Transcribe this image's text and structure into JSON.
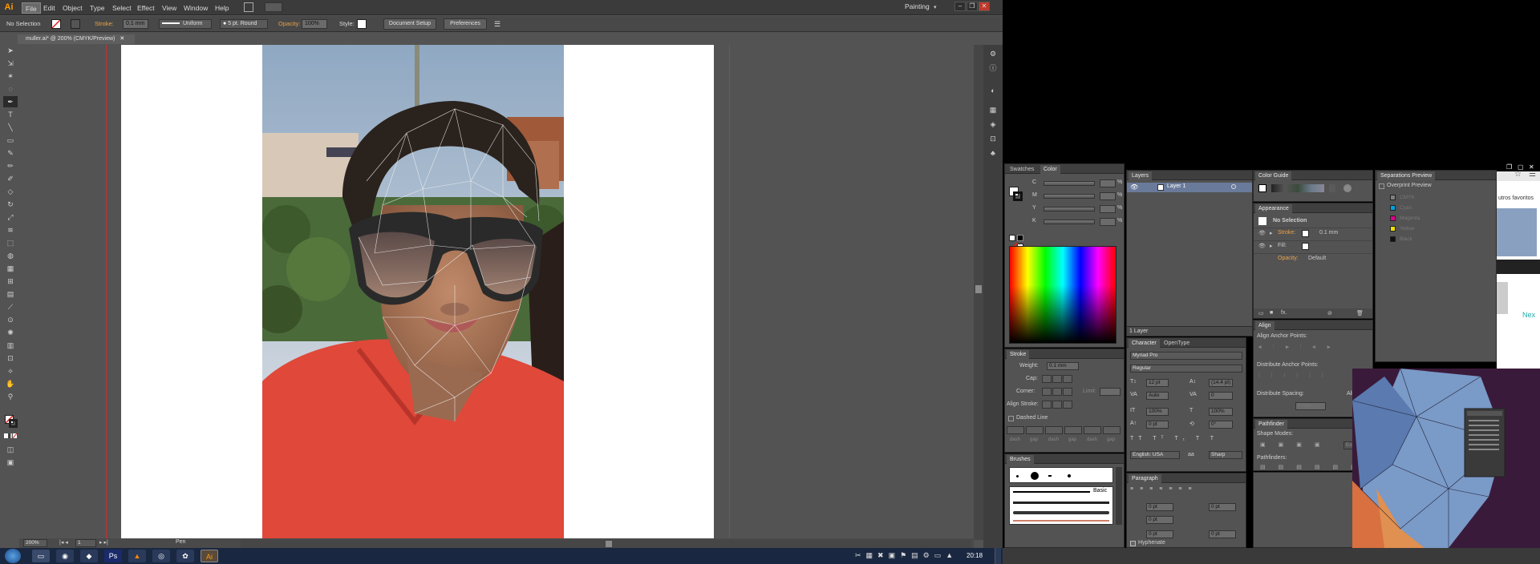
{
  "menubar": {
    "app_logo": "Ai",
    "items": [
      "File",
      "Edit",
      "Object",
      "Type",
      "Select",
      "Effect",
      "View",
      "Window",
      "Help"
    ],
    "workspace": "Painting"
  },
  "control_bar": {
    "selection": "No Selection",
    "stroke_label": "Stroke:",
    "stroke_value": "0.1 mm",
    "profile": "Uniform",
    "brush": "5 pt. Round",
    "opacity_label": "Opacity:",
    "opacity_value": "100%",
    "style_label": "Style:",
    "document_setup": "Document Setup",
    "preferences": "Preferences"
  },
  "document": {
    "tab_title": "muller.ai* @ 200% (CMYK/Preview)",
    "zoom": "200%",
    "page": "1",
    "status": "Pen"
  },
  "panels": {
    "swatches_tab": "Swatches",
    "color_tab": "Color",
    "color_labels": [
      "C",
      "M",
      "Y",
      "K"
    ],
    "percent": "%",
    "stroke": {
      "title": "Stroke",
      "weight_label": "Weight:",
      "weight_value": "0.1 mm",
      "cap_label": "Cap:",
      "corner_label": "Corner:",
      "limit_label": "Limit:",
      "align_label": "Align Stroke:",
      "dashed_label": "Dashed Line",
      "dash_labels": [
        "dash",
        "gap",
        "dash",
        "gap",
        "dash",
        "gap"
      ]
    },
    "brushes": {
      "title": "Brushes",
      "basic": "Basic"
    },
    "layers": {
      "title": "Layers",
      "layer1": "Layer 1",
      "count": "1 Layer"
    },
    "character": {
      "tab1": "Character",
      "tab2": "OpenType",
      "font": "Myriad Pro",
      "style": "Regular",
      "size": "12 pt",
      "leading": "(14.4 pt)",
      "kerning": "Auto",
      "tracking": "0",
      "vscale": "100%",
      "hscale": "100%",
      "baseline": "0 pt",
      "rotation": "0°",
      "language": "English: USA",
      "aa": "Sharp"
    },
    "paragraph": {
      "title": "Paragraph",
      "indent_values": [
        "0 pt",
        "0 pt",
        "0 pt",
        "0 pt",
        "0 pt"
      ],
      "hyphenate": "Hyphenate"
    },
    "color_guide": {
      "title": "Color Guide"
    },
    "appearance": {
      "title": "Appearance",
      "selection": "No Selection",
      "stroke_label": "Stroke:",
      "stroke_value": "0.1 mm",
      "fill_label": "Fill:",
      "opacity_label": "Opacity:",
      "opacity_value": "Default"
    },
    "align": {
      "title": "Align",
      "anchor_points": "Align Anchor Points:",
      "distribute_anchor": "Distribute Anchor Points:",
      "distribute_spacing": "Distribute Spacing:",
      "align_to": "Align To:",
      "spacing_value": "0 mm"
    },
    "pathfinder": {
      "title": "Pathfinder",
      "shape_modes": "Shape Modes:",
      "expand": "Expand",
      "pathfinders": "Pathfinders:"
    },
    "separations": {
      "title": "Separations Preview",
      "overprint": "Overprint Preview",
      "plates": [
        {
          "name": "CMYK",
          "color": "#808080"
        },
        {
          "name": "Cyan",
          "color": "#00a0e0"
        },
        {
          "name": "Magenta",
          "color": "#e0008c"
        },
        {
          "name": "Yellow",
          "color": "#f0e000"
        },
        {
          "name": "Black",
          "color": "#111111"
        }
      ]
    }
  },
  "browser": {
    "favorites_text": "utros favoritos",
    "next_text": "Nex"
  },
  "taskbar": {
    "clock": "20:18"
  },
  "colors": {
    "accent_orange": "#e8a24a",
    "guide_red": "#c83232",
    "skin": "#b07a5a",
    "shirt": "#e0483a"
  }
}
